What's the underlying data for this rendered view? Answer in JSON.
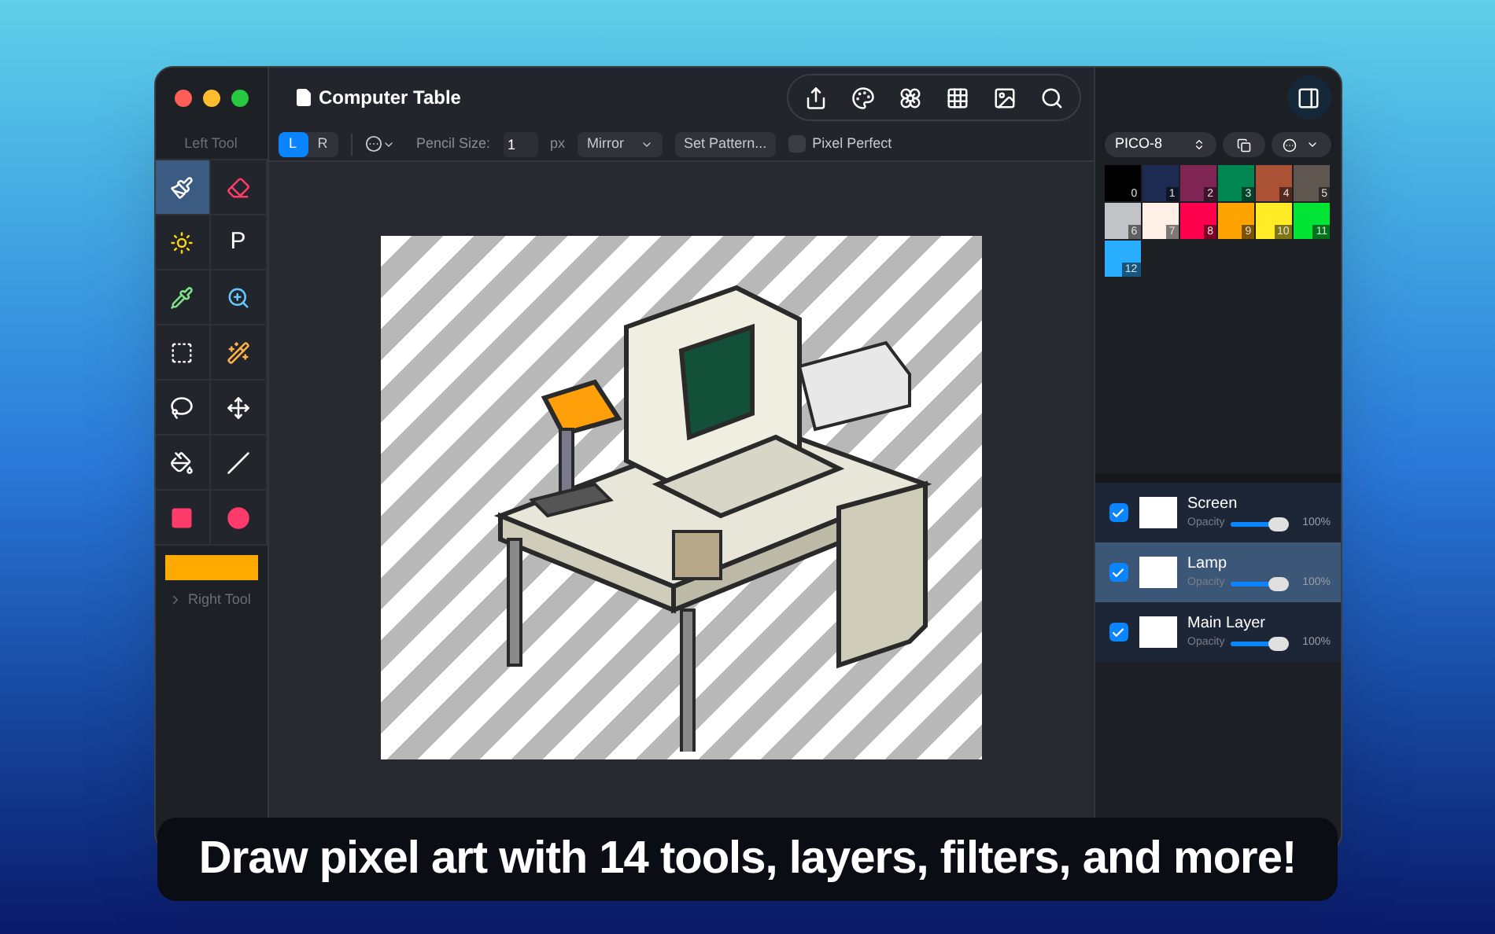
{
  "window": {
    "title": "Computer Table"
  },
  "toolbar": {
    "left_tool_label": "Left Tool",
    "sides": [
      {
        "label": "L",
        "selected": true
      },
      {
        "label": "R",
        "selected": false
      }
    ],
    "pencil_size_label": "Pencil Size:",
    "pencil_size": "1",
    "unit": "px",
    "mirror": "Mirror",
    "set_pattern": "Set Pattern...",
    "pixel_perfect": {
      "label": "Pixel Perfect",
      "checked": false
    }
  },
  "tools": [
    {
      "selected": true
    },
    {
      "selected": false
    },
    {
      "selected": false
    },
    {
      "label": "P",
      "selected": false
    },
    {
      "selected": false
    },
    {
      "selected": false
    },
    {
      "selected": false
    },
    {
      "selected": false
    },
    {
      "selected": false
    },
    {
      "selected": false
    },
    {
      "selected": false
    },
    {
      "selected": false
    },
    {
      "selected": false
    },
    {
      "selected": false
    }
  ],
  "right_tool": {
    "label": "Right Tool",
    "expanded": false
  },
  "palette": {
    "name": "PICO-8",
    "swatches": [
      {
        "label": "0",
        "color": "#000000"
      },
      {
        "label": "1",
        "color": "#1d2b53"
      },
      {
        "label": "2",
        "color": "#7e2553"
      },
      {
        "label": "3",
        "color": "#008751"
      },
      {
        "label": "4",
        "color": "#ab5236"
      },
      {
        "label": "5",
        "color": "#5f574f"
      },
      {
        "label": "6",
        "color": "#c2c3c7"
      },
      {
        "label": "7",
        "color": "#fff1e8"
      },
      {
        "label": "8",
        "color": "#ff004d"
      },
      {
        "label": "9",
        "color": "#ffa300"
      },
      {
        "label": "10",
        "color": "#ffec27"
      },
      {
        "label": "11",
        "color": "#00e436"
      },
      {
        "label": "12",
        "color": "#29adff"
      }
    ]
  },
  "left_tool_color": {
    "color": "#ffaa00"
  },
  "layers": [
    {
      "name": "Screen",
      "visible": true,
      "selected": false,
      "opacity_label": "Opacity",
      "level": 1,
      "reading": "100%"
    },
    {
      "name": "Lamp",
      "visible": true,
      "selected": true,
      "opacity_label": "Opacity",
      "level": 1,
      "reading": "100%"
    },
    {
      "name": "Main Layer",
      "visible": true,
      "selected": false,
      "opacity_label": "Opacity",
      "level": 1,
      "reading": "100%"
    }
  ],
  "caption": "Draw pixel art with 14 tools, layers, filters, and more!"
}
